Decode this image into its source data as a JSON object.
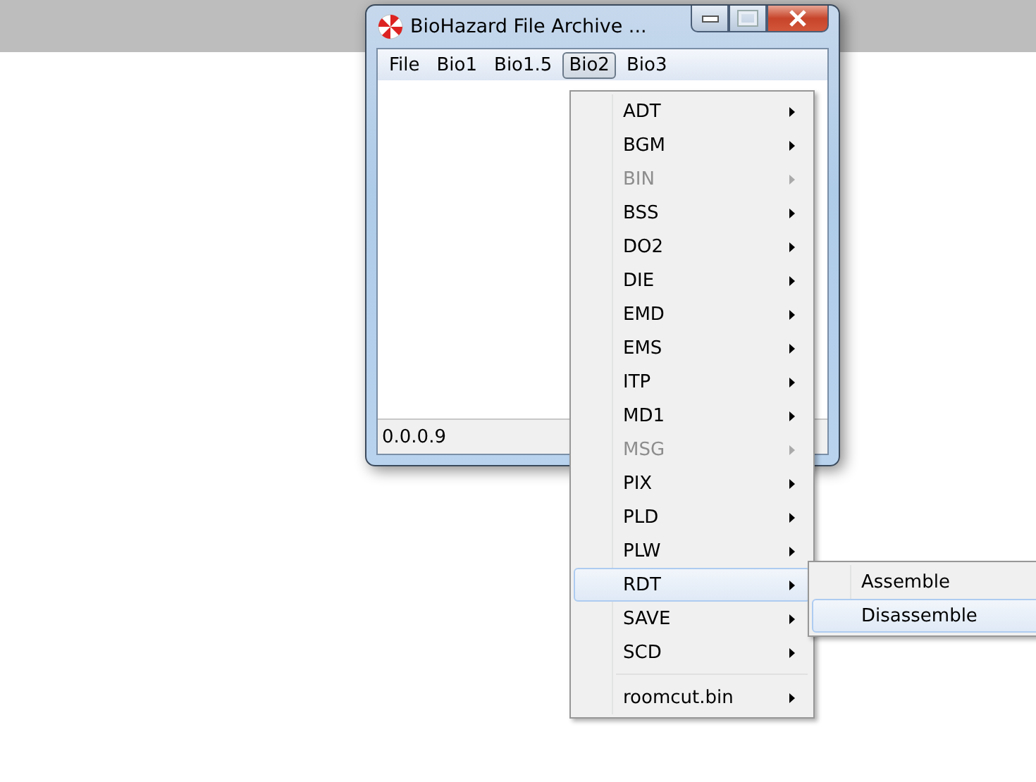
{
  "window": {
    "title": "BioHazard File Archive ..."
  },
  "menu_bar": [
    {
      "label": "File",
      "selected": false
    },
    {
      "label": "Bio1",
      "selected": false
    },
    {
      "label": "Bio1.5",
      "selected": false
    },
    {
      "label": "Bio2",
      "selected": true
    },
    {
      "label": "Bio3",
      "selected": false
    }
  ],
  "dropdown": [
    {
      "kind": "submenu",
      "label": "ADT",
      "disabled": false,
      "selected": false
    },
    {
      "kind": "submenu",
      "label": "BGM",
      "disabled": false,
      "selected": false
    },
    {
      "kind": "submenu",
      "label": "BIN",
      "disabled": true,
      "selected": false
    },
    {
      "kind": "submenu",
      "label": "BSS",
      "disabled": false,
      "selected": false
    },
    {
      "kind": "submenu",
      "label": "DO2",
      "disabled": false,
      "selected": false
    },
    {
      "kind": "submenu",
      "label": "DIE",
      "disabled": false,
      "selected": false
    },
    {
      "kind": "submenu",
      "label": "EMD",
      "disabled": false,
      "selected": false
    },
    {
      "kind": "submenu",
      "label": "EMS",
      "disabled": false,
      "selected": false
    },
    {
      "kind": "submenu",
      "label": "ITP",
      "disabled": false,
      "selected": false
    },
    {
      "kind": "submenu",
      "label": "MD1",
      "disabled": false,
      "selected": false
    },
    {
      "kind": "submenu",
      "label": "MSG",
      "disabled": true,
      "selected": false
    },
    {
      "kind": "submenu",
      "label": "PIX",
      "disabled": false,
      "selected": false
    },
    {
      "kind": "submenu",
      "label": "PLD",
      "disabled": false,
      "selected": false
    },
    {
      "kind": "submenu",
      "label": "PLW",
      "disabled": false,
      "selected": false
    },
    {
      "kind": "submenu",
      "label": "RDT",
      "disabled": false,
      "selected": true
    },
    {
      "kind": "submenu",
      "label": "SAVE",
      "disabled": false,
      "selected": false
    },
    {
      "kind": "submenu",
      "label": "SCD",
      "disabled": false,
      "selected": false
    },
    {
      "kind": "separator"
    },
    {
      "kind": "submenu",
      "label": "roomcut.bin",
      "disabled": false,
      "selected": false
    }
  ],
  "submenu": [
    {
      "label": "Assemble",
      "selected": false
    },
    {
      "label": "Disassemble",
      "selected": true
    }
  ],
  "status_bar": {
    "text": "0.0.0.9"
  }
}
